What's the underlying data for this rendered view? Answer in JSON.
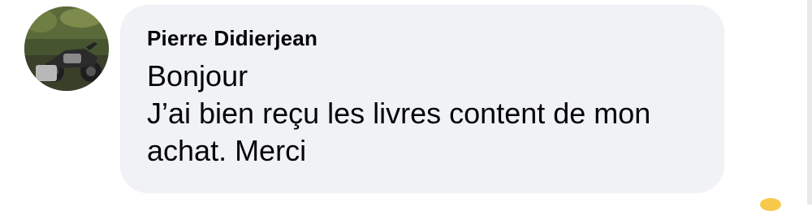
{
  "comment": {
    "author": "Pierre Didierjean",
    "message_lines": [
      "Bonjour",
      "J’ai bien reçu les livres content de mon achat. Merci"
    ],
    "avatar_icon": "profile-photo-motorcycle",
    "bubble_color": "#f0f2f5",
    "text_color": "#050505"
  }
}
